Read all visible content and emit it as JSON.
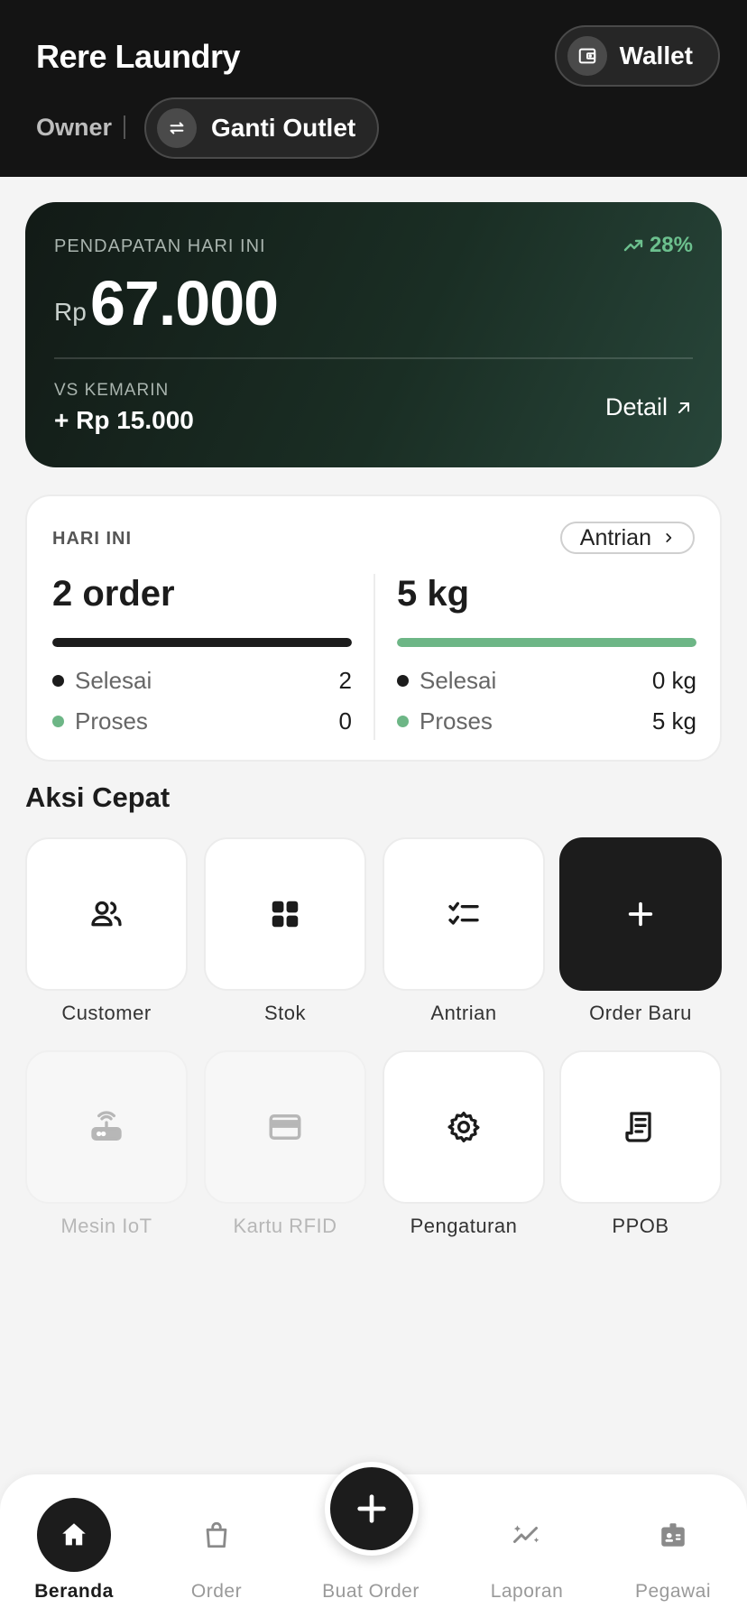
{
  "header": {
    "title": "Rere Laundry",
    "wallet_label": "Wallet",
    "role": "Owner",
    "switch_outlet_label": "Ganti Outlet"
  },
  "revenue": {
    "label": "PENDAPATAN HARI INI",
    "trend": "28%",
    "currency": "Rp",
    "amount": "67.000",
    "vs_label": "VS KEMARIN",
    "vs_value": "+ Rp 15.000",
    "detail_label": "Detail"
  },
  "today": {
    "label": "HARI INI",
    "queue_label": "Antrian",
    "orders": {
      "total": "2 order",
      "progress": 1.0,
      "done_label": "Selesai",
      "done_value": "2",
      "process_label": "Proses",
      "process_value": "0"
    },
    "weight": {
      "total": "5 kg",
      "progress": 1.0,
      "done_label": "Selesai",
      "done_value": "0 kg",
      "process_label": "Proses",
      "process_value": "5 kg"
    }
  },
  "quick_actions": {
    "title": "Aksi Cepat",
    "items": [
      {
        "label": "Customer",
        "icon": "users-icon"
      },
      {
        "label": "Stok",
        "icon": "grid-icon"
      },
      {
        "label": "Antrian",
        "icon": "checklist-icon"
      },
      {
        "label": "Order Baru",
        "icon": "plus-icon"
      },
      {
        "label": "Mesin IoT",
        "icon": "router-icon"
      },
      {
        "label": "Kartu RFID",
        "icon": "card-icon"
      },
      {
        "label": "Pengaturan",
        "icon": "gear-icon"
      },
      {
        "label": "PPOB",
        "icon": "receipt-icon"
      }
    ]
  },
  "bottom_nav": {
    "items": [
      {
        "label": "Beranda",
        "icon": "home-icon"
      },
      {
        "label": "Order",
        "icon": "bag-icon"
      },
      {
        "label": "Buat Order",
        "icon": "plus-icon"
      },
      {
        "label": "Laporan",
        "icon": "sparkline-icon"
      },
      {
        "label": "Pegawai",
        "icon": "badge-icon"
      }
    ]
  },
  "colors": {
    "header_bg": "#141414",
    "accent_green": "#6cc08e",
    "dark": "#1c1c1c",
    "bar_green": "#6db686"
  }
}
